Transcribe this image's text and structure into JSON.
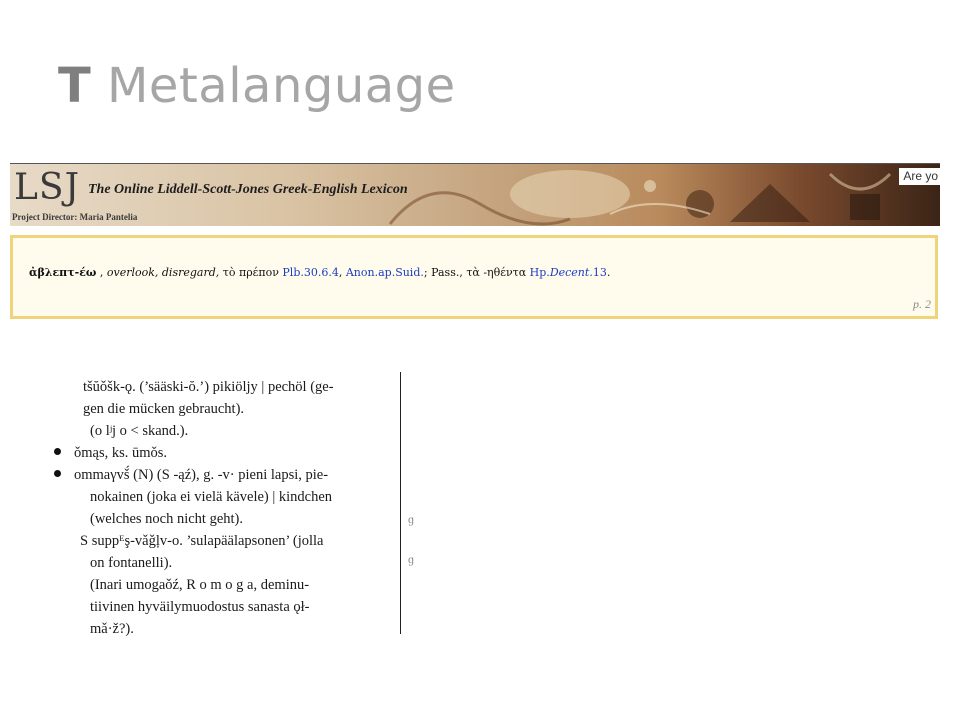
{
  "slide": {
    "title_letter": "T",
    "title_rest": " Metalanguage"
  },
  "lsj": {
    "logo": "LSJ",
    "subtitle": "The Online Liddell-Scott-Jones Greek-English Lexicon",
    "director": "Project Director: Maria Pantelia",
    "are_you": "Are yo",
    "entry": {
      "headword": "ἀβλεπτ-έω",
      "sep1": " , ",
      "gloss": "overlook, disregard,",
      "greek1": " τὸ πρέπον ",
      "ref1": "Plb.30.6.4",
      "sep2": ", ",
      "ref2": "Anon.ap.Suid.",
      "mid": "; Pass., τὰ -ηθέντα ",
      "ref3_a": "Hp.",
      "ref3_b": "Decent.",
      "ref3_c": "13",
      "end": "."
    },
    "page": "p. 2"
  },
  "scan": {
    "lines": [
      "tšŭǒšk-ǫ. (’sääski-ŏ.’) pikiöljy | pechöl (ge-",
      "gen die mücken gebraucht).",
      "(o lʲj o < skand.).",
      "ǒmąs, ks. ūmǒs.",
      "ommaγvš́ (N) (S -ąź), g. -v· pieni lapsi, pie-",
      "nokainen (joka ei vielä kävele) | kindchen",
      "(welches noch nicht geht).",
      "S suppᴱş-vǎǧļv-o. ’sulapäälapsonen’ (jolla",
      "on fontanelli).",
      "(Inari umogaǒź, R o m o g a, deminu-",
      "tiivinen hyväilymuodostus sanasta ǫł-",
      "mǎ·ž?)."
    ],
    "margin_marks": [
      "ɡ",
      "ɡ"
    ]
  }
}
